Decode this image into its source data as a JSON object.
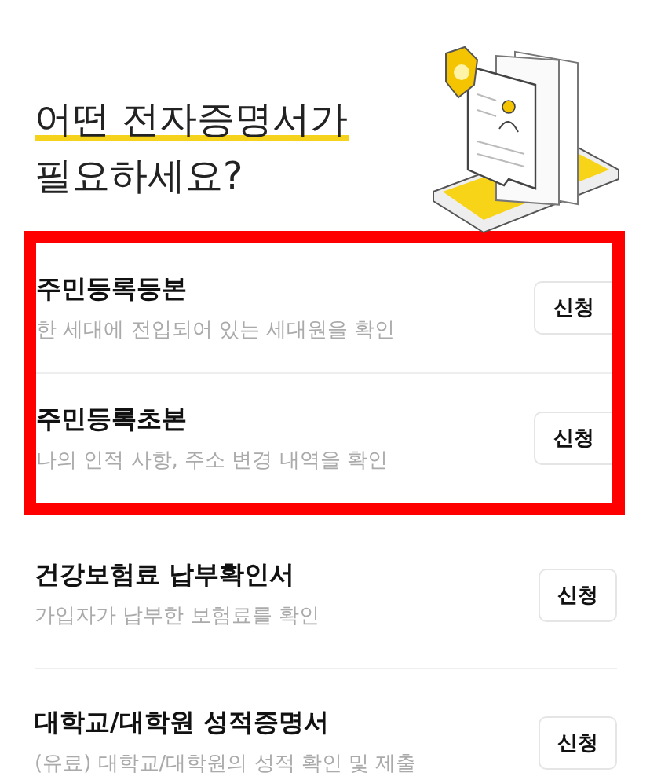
{
  "heading": {
    "line_1": "어떤 전자증명서가",
    "line_2": "필요하세요?"
  },
  "groups": [
    {
      "highlighted": true,
      "items": [
        {
          "title": "주민등록등본",
          "description": "한 세대에 전입되어 있는 세대원을 확인",
          "button": "신청"
        },
        {
          "title": "주민등록초본",
          "description": "나의 인적 사항, 주소 변경 내역을 확인",
          "button": "신청"
        }
      ]
    },
    {
      "highlighted": false,
      "items": [
        {
          "title": "건강보험료 납부확인서",
          "description": "가입자가 납부한 보험료를 확인",
          "button": "신청"
        },
        {
          "title": "대학교/대학원 성적증명서",
          "description": "(유료) 대학교/대학원의 성적 확인 및 제출",
          "button": "신청"
        }
      ]
    }
  ]
}
